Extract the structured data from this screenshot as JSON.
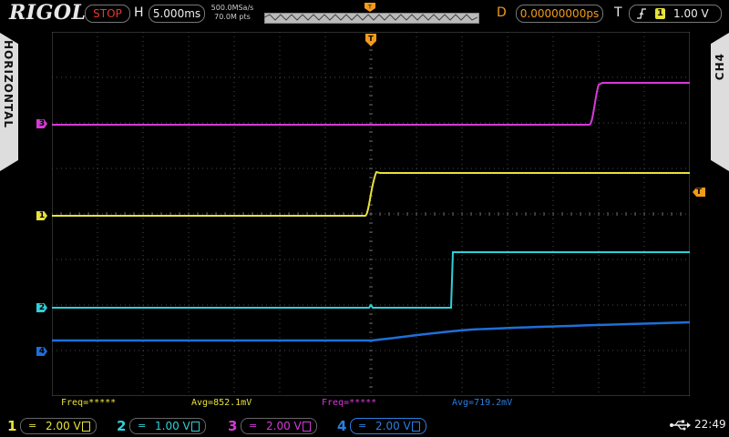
{
  "brand": "RIGOL",
  "run_state": "STOP",
  "horizontal": {
    "label": "H",
    "timebase": "5.000ms",
    "sample_rate": "500.0MSa/s",
    "memory_depth": "70.0M pts",
    "delay_label": "D",
    "delay": "0.00000000ps"
  },
  "trigger": {
    "label": "T",
    "source": "1",
    "level": "1.00 V",
    "marker": "T"
  },
  "side_tabs": {
    "left": "HORIZONTAL",
    "right": "CH4"
  },
  "channel_markers": {
    "ch1": "1",
    "ch2": "2",
    "ch3": "3",
    "ch4": "4"
  },
  "measurements": [
    {
      "text": "Freq=*****",
      "color": "#e8e23a"
    },
    {
      "text": "Avg=852.1mV",
      "color": "#e8e23a"
    },
    {
      "text": "Freq=*****",
      "color": "#d63ad6"
    },
    {
      "text": "Avg=719.2mV",
      "color": "#2b7fe0"
    }
  ],
  "channels": [
    {
      "num": "1",
      "coupling": "=",
      "scale": "2.00 V",
      "color": "#e8e23a"
    },
    {
      "num": "2",
      "coupling": "=",
      "scale": "1.00 V",
      "color": "#2fd0d8"
    },
    {
      "num": "3",
      "coupling": "=",
      "scale": "2.00 V",
      "color": "#d63ad6"
    },
    {
      "num": "4",
      "coupling": "=",
      "scale": "2.00 V",
      "color": "#2b7fe0"
    }
  ],
  "clock": "22:49",
  "colors": {
    "ch1": "#e8e23a",
    "ch2": "#2fd0d8",
    "ch3": "#d63ad6",
    "ch4": "#1e6fd8",
    "trigger": "#f29b1a",
    "stop": "#e23c2c",
    "grid": "#4a4a4a"
  }
}
